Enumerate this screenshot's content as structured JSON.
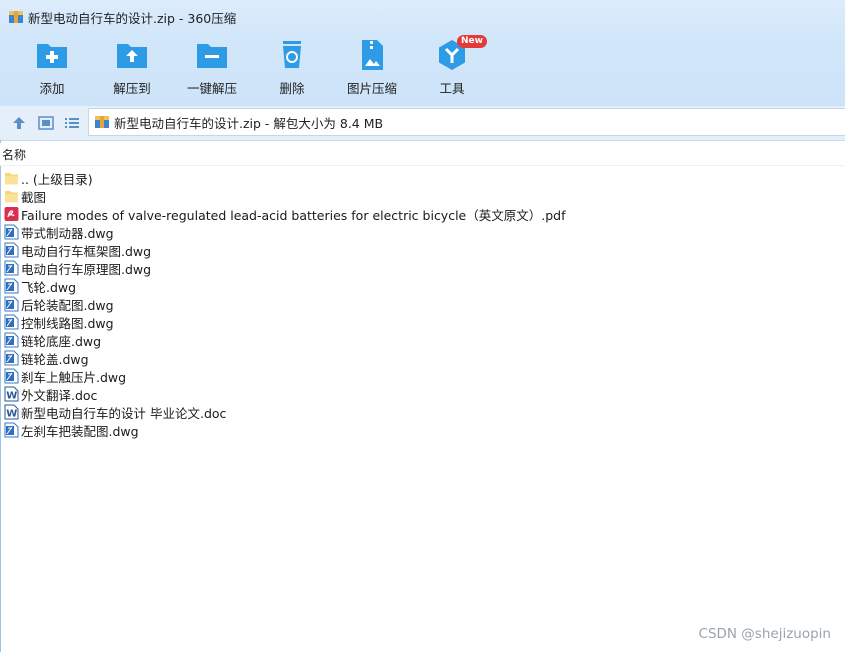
{
  "window": {
    "title": "新型电动自行车的设计.zip - 360压缩"
  },
  "toolbar": {
    "buttons": [
      {
        "label": "添加",
        "icon": "add-icon"
      },
      {
        "label": "解压到",
        "icon": "extract-to-icon"
      },
      {
        "label": "一键解压",
        "icon": "one-click-extract-icon"
      },
      {
        "label": "删除",
        "icon": "delete-icon"
      },
      {
        "label": "图片压缩",
        "icon": "image-compress-icon"
      },
      {
        "label": "工具",
        "icon": "tools-icon"
      }
    ],
    "tools_badge": "New"
  },
  "address": {
    "text": "新型电动自行车的设计.zip - 解包大小为 8.4 MB"
  },
  "columns": {
    "name": "名称"
  },
  "files": [
    {
      "name": ".. (上级目录)",
      "type": "folder"
    },
    {
      "name": "截图",
      "type": "folder"
    },
    {
      "name": "Failure modes of valve-regulated lead-acid batteries for electric bicycle（英文原文）.pdf",
      "type": "pdf"
    },
    {
      "name": "带式制动器.dwg",
      "type": "dwg"
    },
    {
      "name": "电动自行车框架图.dwg",
      "type": "dwg"
    },
    {
      "name": "电动自行车原理图.dwg",
      "type": "dwg"
    },
    {
      "name": "飞轮.dwg",
      "type": "dwg"
    },
    {
      "name": "后轮装配图.dwg",
      "type": "dwg"
    },
    {
      "name": "控制线路图.dwg",
      "type": "dwg"
    },
    {
      "name": "链轮底座.dwg",
      "type": "dwg"
    },
    {
      "name": "链轮盖.dwg",
      "type": "dwg"
    },
    {
      "name": "刹车上触压片.dwg",
      "type": "dwg"
    },
    {
      "name": "外文翻译.doc",
      "type": "doc"
    },
    {
      "name": "新型电动自行车的设计 毕业论文.doc",
      "type": "doc"
    },
    {
      "name": "左刹车把装配图.dwg",
      "type": "dwg"
    }
  ],
  "watermark": "CSDN @shejizuopin",
  "colors": {
    "accent": "#2d9be6",
    "toolbar_bg": "#d3e7fa",
    "pdf": "#d9304f"
  }
}
